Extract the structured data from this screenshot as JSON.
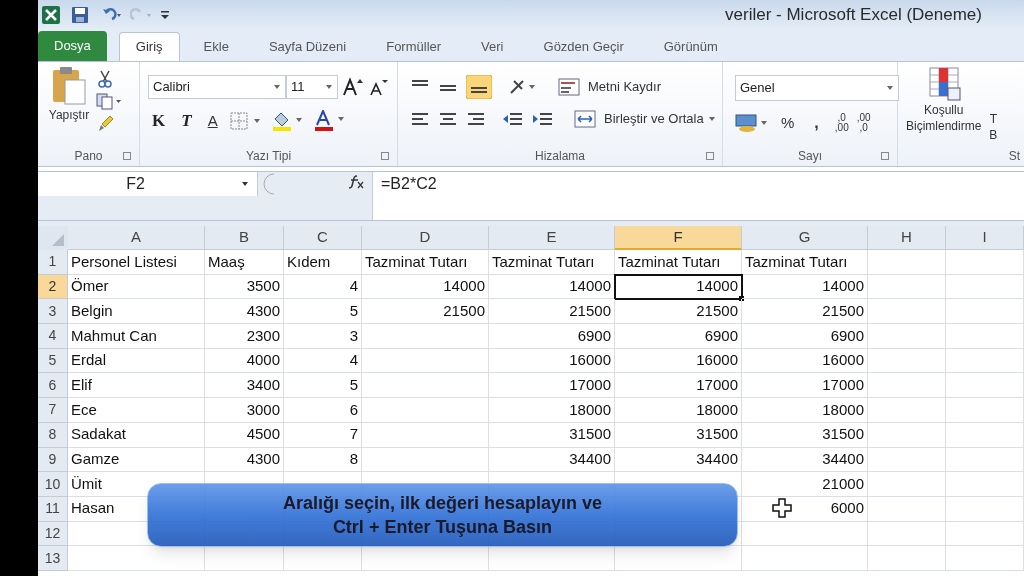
{
  "window": {
    "title": "veriler  -  Microsoft Excel (Deneme)"
  },
  "tabs": [
    {
      "label": "Dosya",
      "kind": "file",
      "selected": false
    },
    {
      "label": "Giriş",
      "kind": "tab",
      "selected": true
    },
    {
      "label": "Ekle",
      "kind": "tab",
      "selected": false
    },
    {
      "label": "Sayfa Düzeni",
      "kind": "tab",
      "selected": false
    },
    {
      "label": "Formüller",
      "kind": "tab",
      "selected": false
    },
    {
      "label": "Veri",
      "kind": "tab",
      "selected": false
    },
    {
      "label": "Gözden Geçir",
      "kind": "tab",
      "selected": false
    },
    {
      "label": "Görünüm",
      "kind": "tab",
      "selected": false
    }
  ],
  "ribbon": {
    "paste_label": "Yapıştır",
    "font_name": "Calibri",
    "font_size": "11",
    "bold": "K",
    "italic": "T",
    "underline": "A",
    "wrap_text": "Metni Kaydır",
    "merge_center": "Birleştir ve Ortala",
    "number_format": "Genel",
    "percent": "%",
    "comma": ",",
    "increase_decimal": [
      ",0",
      ",00"
    ],
    "decrease_decimal": [
      ",00",
      ",0"
    ],
    "conditional_format": [
      "Koşullu",
      "Biçimlendirme"
    ],
    "next_button": [
      "T",
      "B"
    ],
    "group_labels": [
      "Pano",
      "Yazı Tipi",
      "Hizalama",
      "Sayı",
      "St"
    ]
  },
  "formula_bar": {
    "name_box": "F2",
    "formula": "=B2*C2"
  },
  "columns": [
    {
      "label": "A",
      "selected": false
    },
    {
      "label": "B",
      "selected": false
    },
    {
      "label": "C",
      "selected": false
    },
    {
      "label": "D",
      "selected": false
    },
    {
      "label": "E",
      "selected": false
    },
    {
      "label": "F",
      "selected": true
    },
    {
      "label": "G",
      "selected": false
    },
    {
      "label": "H",
      "selected": false
    },
    {
      "label": "I",
      "selected": false
    }
  ],
  "rows": [
    {
      "number": "1",
      "selected": false,
      "cells": [
        "Personel Listesi",
        "Maaş",
        "Kıdem",
        "Tazminat Tutarı",
        "Tazminat Tutarı",
        "Tazminat Tutarı",
        "Tazminat Tutarı",
        null,
        null
      ]
    },
    {
      "number": "2",
      "selected": true,
      "cells": [
        "Ömer",
        "3500",
        "4",
        "14000",
        "14000",
        "14000",
        "14000",
        null,
        null
      ]
    },
    {
      "number": "3",
      "selected": false,
      "cells": [
        "Belgin",
        "4300",
        "5",
        "21500",
        "21500",
        "21500",
        "21500",
        null,
        null
      ]
    },
    {
      "number": "4",
      "selected": false,
      "cells": [
        "Mahmut Can",
        "2300",
        "3",
        null,
        "6900",
        "6900",
        "6900",
        null,
        null
      ]
    },
    {
      "number": "5",
      "selected": false,
      "cells": [
        "Erdal",
        "4000",
        "4",
        null,
        "16000",
        "16000",
        "16000",
        null,
        null
      ]
    },
    {
      "number": "6",
      "selected": false,
      "cells": [
        "Elif",
        "3400",
        "5",
        null,
        "17000",
        "17000",
        "17000",
        null,
        null
      ]
    },
    {
      "number": "7",
      "selected": false,
      "cells": [
        "Ece",
        "3000",
        "6",
        null,
        "18000",
        "18000",
        "18000",
        null,
        null
      ]
    },
    {
      "number": "8",
      "selected": false,
      "cells": [
        "Sadakat",
        "4500",
        "7",
        null,
        "31500",
        "31500",
        "31500",
        null,
        null
      ]
    },
    {
      "number": "9",
      "selected": false,
      "cells": [
        "Gamze",
        "4300",
        "8",
        null,
        "34400",
        "34400",
        "34400",
        null,
        null
      ]
    },
    {
      "number": "10",
      "selected": false,
      "cells": [
        "Ümit",
        null,
        null,
        null,
        null,
        null,
        "21000",
        null,
        null
      ]
    },
    {
      "number": "11",
      "selected": false,
      "cells": [
        "Hasan",
        null,
        null,
        null,
        null,
        null,
        "6000",
        null,
        null
      ]
    },
    {
      "number": "12",
      "selected": false,
      "cells": [
        null,
        null,
        null,
        null,
        null,
        null,
        null,
        null,
        null
      ]
    },
    {
      "number": "13",
      "selected": false,
      "cells": [
        null,
        null,
        null,
        null,
        null,
        null,
        null,
        null,
        null
      ]
    }
  ],
  "callout": {
    "lines": [
      "Aralığı seçin, ilk değeri hesaplayın ve",
      "Ctrl + Enter Tuşuna Basın"
    ]
  }
}
